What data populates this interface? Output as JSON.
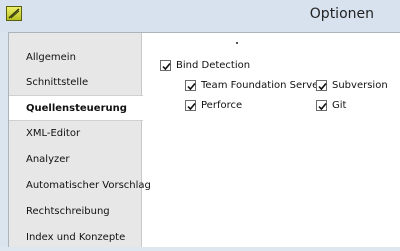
{
  "window": {
    "title": "Optionen"
  },
  "sidebar": {
    "items": [
      {
        "label": "Allgemein",
        "active": false
      },
      {
        "label": "Schnittstelle",
        "active": false
      },
      {
        "label": "Quellensteuerung",
        "active": true
      },
      {
        "label": "XML-Editor",
        "active": false
      },
      {
        "label": "Analyzer",
        "active": false
      },
      {
        "label": "Automatischer Vorschlag",
        "active": false
      },
      {
        "label": "Rechtschreibung",
        "active": false
      },
      {
        "label": "Index und Konzepte",
        "active": false
      }
    ]
  },
  "settings": {
    "bind_detection": {
      "label": "Bind Detection",
      "checked": true
    },
    "providers": [
      {
        "label": "Team Foundation Server",
        "checked": true
      },
      {
        "label": "Subversion",
        "checked": true
      },
      {
        "label": "Perforce",
        "checked": true
      },
      {
        "label": "Git",
        "checked": true
      }
    ]
  },
  "colors": {
    "titlebar": "#d8e2ee",
    "sidebar": "#e7e7e7",
    "active_item": "#ffffff"
  }
}
